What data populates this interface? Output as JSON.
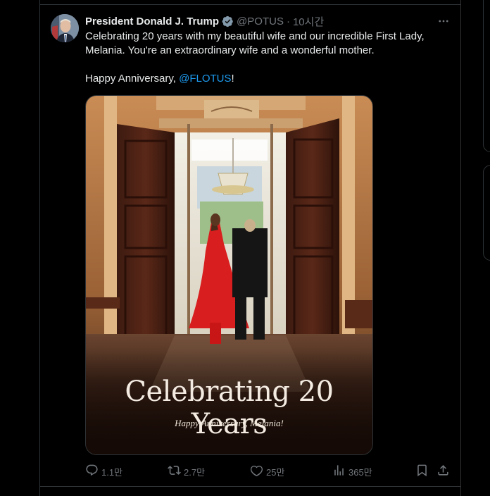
{
  "tweet": {
    "author_name": "President Donald J. Trump",
    "handle": "@POTUS",
    "separator": "·",
    "time": "10시간",
    "line1": "Celebrating 20 years with my beautiful wife and our incredible First Lady,",
    "line2": "Melania. You're an extraordinary wife and a wonderful mother.",
    "line3_prefix": "Happy Anniversary, ",
    "mention": "@FLOTUS",
    "line3_suffix": "!"
  },
  "media": {
    "caption_title": "Celebrating 20 Years",
    "caption_sub": "Happy Anniversary, Melania!"
  },
  "actions": {
    "replies": "1.1만",
    "reposts": "2.7만",
    "likes": "25만",
    "views": "365만"
  },
  "icons": [
    "verified-badge-icon",
    "more-icon",
    "reply-icon",
    "repost-icon",
    "like-icon",
    "views-icon",
    "bookmark-icon",
    "share-icon"
  ],
  "colors": {
    "background": "#000000",
    "text": "#e7e9ea",
    "muted": "#71767b",
    "link": "#1d9bf0",
    "verified": "#829aab"
  }
}
